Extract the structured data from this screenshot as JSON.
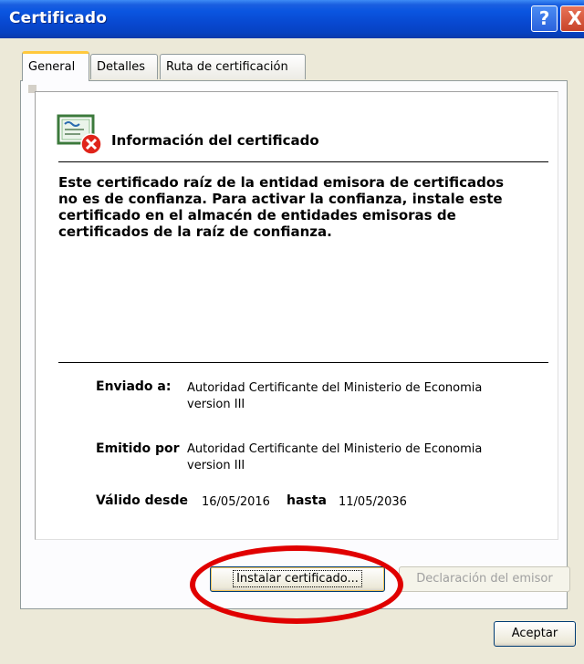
{
  "window": {
    "title": "Certificado"
  },
  "titlebar": {
    "help_glyph": "?",
    "close_glyph": "X"
  },
  "tabs": [
    {
      "label": "General",
      "active": true
    },
    {
      "label": "Detalles",
      "active": false
    },
    {
      "label": "Ruta de certificación",
      "active": false
    }
  ],
  "general": {
    "info_title": "Información del certificado",
    "warning_lines": [
      "Este certificado raíz de la entidad emisora de certificados",
      "no es de confianza. Para activar la confianza, instale este",
      "certificado en el almacén de entidades emisoras de",
      "certificados de la raíz de confianza."
    ],
    "issued_to_label": "Enviado a:",
    "issued_to_value": [
      "Autoridad Certificante del Ministerio de Economia",
      "version III"
    ],
    "issued_by_label": "Emitido por",
    "issued_by_value": [
      "Autoridad Certificante del Ministerio de Economia",
      "version III"
    ],
    "valid_from_label": "Válido desde",
    "valid_from_value": "16/05/2016",
    "valid_to_label": "hasta",
    "valid_to_value": "11/05/2036"
  },
  "buttons": {
    "install": "Instalar certificado...",
    "issuer_statement": "Declaración del emisor",
    "ok": "Aceptar"
  },
  "icons": {
    "certificate": "certificate-icon",
    "error_badge": "error-x-icon",
    "help": "help-icon",
    "close": "close-icon"
  },
  "colors": {
    "titlebar": "#0a55e0",
    "dialog_bg": "#ece9d8",
    "active_tab_accent": "#ffc83c",
    "highlight_oval": "#e00000"
  }
}
